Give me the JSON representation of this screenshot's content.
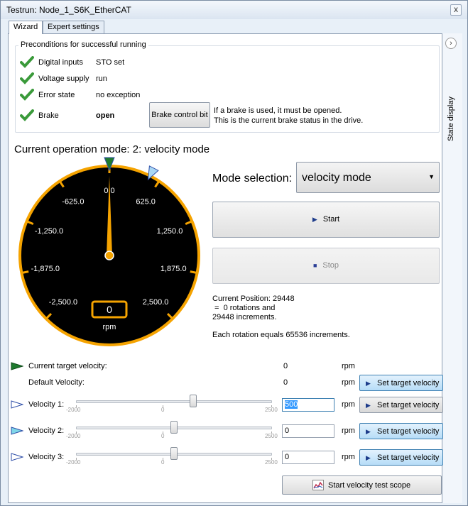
{
  "window": {
    "title": "Testrun: Node_1_S6K_EtherCAT",
    "close_glyph": "x"
  },
  "tabs": [
    {
      "label": "Wizard",
      "active": true
    },
    {
      "label": "Expert settings",
      "active": false
    }
  ],
  "sidebar": {
    "label": "State display",
    "toggle_icon": "chevron-right-icon"
  },
  "preconditions": {
    "title": "Preconditions for successful running",
    "rows": [
      {
        "label": "Digital inputs",
        "value": "STO set",
        "ok": true
      },
      {
        "label": "Voltage supply",
        "value": "run",
        "ok": true
      },
      {
        "label": "Error state",
        "value": "no exception",
        "ok": true
      },
      {
        "label": "Brake",
        "value": "open",
        "ok": true
      }
    ],
    "brake_button": "Brake control bit",
    "brake_info_line1": "If a brake is used, it must be opened.",
    "brake_info_line2": "This is the current brake status in the drive."
  },
  "operation_mode_title": "Current operation mode: 2: velocity mode",
  "gauge": {
    "unit": "rpm",
    "readout": "0",
    "scale_labels": [
      "-2,500.0",
      "-1,875.0",
      "-1,250.0",
      "-625.0",
      "0.0",
      "625.0",
      "1,250.0",
      "1,875.0",
      "2,500.0"
    ],
    "min": -2500,
    "max": 2500,
    "needle_value": 0,
    "current_target_marker": 0,
    "velocity1_marker": 500,
    "colors": {
      "ring": "#f5a300",
      "face": "#000000",
      "needle": "#f5a300",
      "marker_current": "#1e7a2e",
      "marker_v1": "#a9d7f4"
    }
  },
  "mode_selection": {
    "label": "Mode selection:",
    "value": "velocity mode"
  },
  "buttons": {
    "start": "Start",
    "stop": "Stop",
    "set_target": "Set target velocity",
    "scope": "Start velocity test scope"
  },
  "info": {
    "line1": "Current Position: 29448",
    "line2": " =  0 rotations and",
    "line3": "29448 increments.",
    "line4": "Each rotation equals 65536 increments."
  },
  "velocities": {
    "unit": "rpm",
    "current_target": {
      "label": "Current target velocity:",
      "value": "0"
    },
    "default": {
      "label": "Default Velocity:",
      "value": "0"
    },
    "items": [
      {
        "label": "Velocity 1:",
        "value": "500",
        "slider_fraction": 0.6
      },
      {
        "label": "Velocity 2:",
        "value": "0",
        "slider_fraction": 0.5
      },
      {
        "label": "Velocity 3:",
        "value": "0",
        "slider_fraction": 0.5
      }
    ],
    "slider_min": "-2000",
    "slider_mid": "0",
    "slider_max": "2500"
  }
}
